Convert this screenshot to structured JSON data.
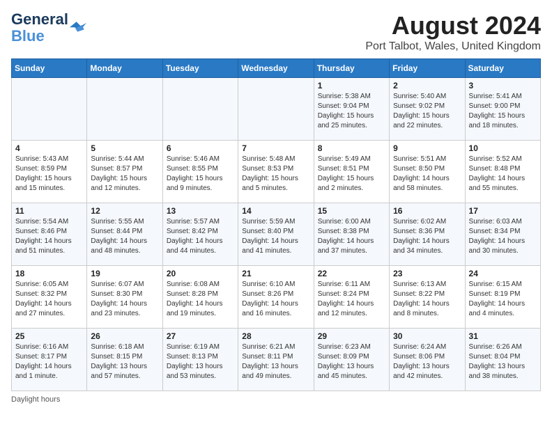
{
  "logo": {
    "line1": "General",
    "line2": "Blue"
  },
  "title": "August 2024",
  "subtitle": "Port Talbot, Wales, United Kingdom",
  "days_of_week": [
    "Sunday",
    "Monday",
    "Tuesday",
    "Wednesday",
    "Thursday",
    "Friday",
    "Saturday"
  ],
  "weeks": [
    [
      {
        "day": "",
        "info": ""
      },
      {
        "day": "",
        "info": ""
      },
      {
        "day": "",
        "info": ""
      },
      {
        "day": "",
        "info": ""
      },
      {
        "day": "1",
        "info": "Sunrise: 5:38 AM\nSunset: 9:04 PM\nDaylight: 15 hours\nand 25 minutes."
      },
      {
        "day": "2",
        "info": "Sunrise: 5:40 AM\nSunset: 9:02 PM\nDaylight: 15 hours\nand 22 minutes."
      },
      {
        "day": "3",
        "info": "Sunrise: 5:41 AM\nSunset: 9:00 PM\nDaylight: 15 hours\nand 18 minutes."
      }
    ],
    [
      {
        "day": "4",
        "info": "Sunrise: 5:43 AM\nSunset: 8:59 PM\nDaylight: 15 hours\nand 15 minutes."
      },
      {
        "day": "5",
        "info": "Sunrise: 5:44 AM\nSunset: 8:57 PM\nDaylight: 15 hours\nand 12 minutes."
      },
      {
        "day": "6",
        "info": "Sunrise: 5:46 AM\nSunset: 8:55 PM\nDaylight: 15 hours\nand 9 minutes."
      },
      {
        "day": "7",
        "info": "Sunrise: 5:48 AM\nSunset: 8:53 PM\nDaylight: 15 hours\nand 5 minutes."
      },
      {
        "day": "8",
        "info": "Sunrise: 5:49 AM\nSunset: 8:51 PM\nDaylight: 15 hours\nand 2 minutes."
      },
      {
        "day": "9",
        "info": "Sunrise: 5:51 AM\nSunset: 8:50 PM\nDaylight: 14 hours\nand 58 minutes."
      },
      {
        "day": "10",
        "info": "Sunrise: 5:52 AM\nSunset: 8:48 PM\nDaylight: 14 hours\nand 55 minutes."
      }
    ],
    [
      {
        "day": "11",
        "info": "Sunrise: 5:54 AM\nSunset: 8:46 PM\nDaylight: 14 hours\nand 51 minutes."
      },
      {
        "day": "12",
        "info": "Sunrise: 5:55 AM\nSunset: 8:44 PM\nDaylight: 14 hours\nand 48 minutes."
      },
      {
        "day": "13",
        "info": "Sunrise: 5:57 AM\nSunset: 8:42 PM\nDaylight: 14 hours\nand 44 minutes."
      },
      {
        "day": "14",
        "info": "Sunrise: 5:59 AM\nSunset: 8:40 PM\nDaylight: 14 hours\nand 41 minutes."
      },
      {
        "day": "15",
        "info": "Sunrise: 6:00 AM\nSunset: 8:38 PM\nDaylight: 14 hours\nand 37 minutes."
      },
      {
        "day": "16",
        "info": "Sunrise: 6:02 AM\nSunset: 8:36 PM\nDaylight: 14 hours\nand 34 minutes."
      },
      {
        "day": "17",
        "info": "Sunrise: 6:03 AM\nSunset: 8:34 PM\nDaylight: 14 hours\nand 30 minutes."
      }
    ],
    [
      {
        "day": "18",
        "info": "Sunrise: 6:05 AM\nSunset: 8:32 PM\nDaylight: 14 hours\nand 27 minutes."
      },
      {
        "day": "19",
        "info": "Sunrise: 6:07 AM\nSunset: 8:30 PM\nDaylight: 14 hours\nand 23 minutes."
      },
      {
        "day": "20",
        "info": "Sunrise: 6:08 AM\nSunset: 8:28 PM\nDaylight: 14 hours\nand 19 minutes."
      },
      {
        "day": "21",
        "info": "Sunrise: 6:10 AM\nSunset: 8:26 PM\nDaylight: 14 hours\nand 16 minutes."
      },
      {
        "day": "22",
        "info": "Sunrise: 6:11 AM\nSunset: 8:24 PM\nDaylight: 14 hours\nand 12 minutes."
      },
      {
        "day": "23",
        "info": "Sunrise: 6:13 AM\nSunset: 8:22 PM\nDaylight: 14 hours\nand 8 minutes."
      },
      {
        "day": "24",
        "info": "Sunrise: 6:15 AM\nSunset: 8:19 PM\nDaylight: 14 hours\nand 4 minutes."
      }
    ],
    [
      {
        "day": "25",
        "info": "Sunrise: 6:16 AM\nSunset: 8:17 PM\nDaylight: 14 hours\nand 1 minute."
      },
      {
        "day": "26",
        "info": "Sunrise: 6:18 AM\nSunset: 8:15 PM\nDaylight: 13 hours\nand 57 minutes."
      },
      {
        "day": "27",
        "info": "Sunrise: 6:19 AM\nSunset: 8:13 PM\nDaylight: 13 hours\nand 53 minutes."
      },
      {
        "day": "28",
        "info": "Sunrise: 6:21 AM\nSunset: 8:11 PM\nDaylight: 13 hours\nand 49 minutes."
      },
      {
        "day": "29",
        "info": "Sunrise: 6:23 AM\nSunset: 8:09 PM\nDaylight: 13 hours\nand 45 minutes."
      },
      {
        "day": "30",
        "info": "Sunrise: 6:24 AM\nSunset: 8:06 PM\nDaylight: 13 hours\nand 42 minutes."
      },
      {
        "day": "31",
        "info": "Sunrise: 6:26 AM\nSunset: 8:04 PM\nDaylight: 13 hours\nand 38 minutes."
      }
    ]
  ],
  "footer": "Daylight hours"
}
